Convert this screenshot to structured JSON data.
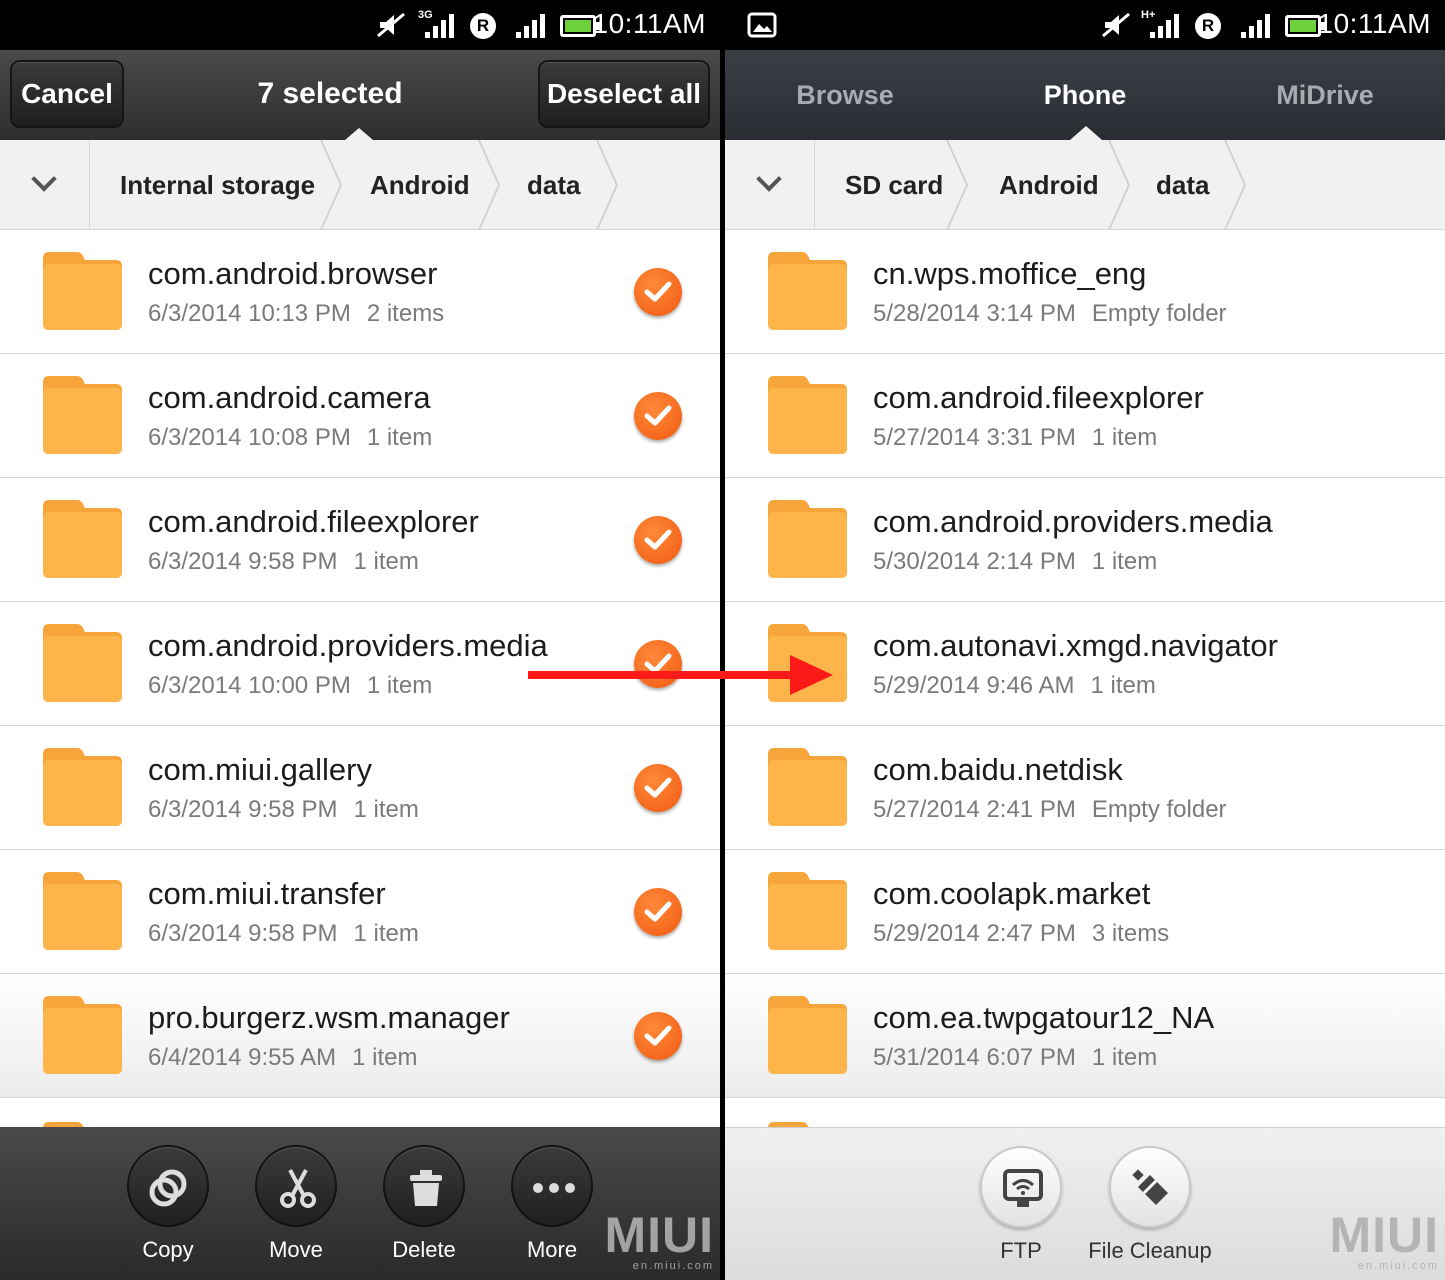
{
  "left": {
    "status": {
      "time": "10:11AM",
      "network": "3G",
      "roaming": "R"
    },
    "topbar": {
      "cancel": "Cancel",
      "title": "7 selected",
      "deselect": "Deselect all"
    },
    "breadcrumb": [
      "Internal storage",
      "Android",
      "data"
    ],
    "rows": [
      {
        "name": "com.android.browser",
        "date": "6/3/2014 10:13 PM",
        "count": "2 items"
      },
      {
        "name": "com.android.camera",
        "date": "6/3/2014 10:08 PM",
        "count": "1 item"
      },
      {
        "name": "com.android.fileexplorer",
        "date": "6/3/2014 9:58 PM",
        "count": "1 item"
      },
      {
        "name": "com.android.providers.media",
        "date": "6/3/2014 10:00 PM",
        "count": "1 item"
      },
      {
        "name": "com.miui.gallery",
        "date": "6/3/2014 9:58 PM",
        "count": "1 item"
      },
      {
        "name": "com.miui.transfer",
        "date": "6/3/2014 9:58 PM",
        "count": "1 item"
      },
      {
        "name": "pro.burgerz.wsm.manager",
        "date": "6/4/2014 9:55 AM",
        "count": "1 item"
      }
    ],
    "toolbar": [
      "Copy",
      "Move",
      "Delete",
      "More"
    ],
    "watermark": {
      "logo": "MIUI",
      "url": "en.miui.com"
    }
  },
  "right": {
    "status": {
      "time": "10:11AM",
      "network": "H+",
      "roaming": "R"
    },
    "tabs": [
      "Browse",
      "Phone",
      "MiDrive"
    ],
    "breadcrumb": [
      "SD card",
      "Android",
      "data"
    ],
    "rows": [
      {
        "name": "cn.wps.moffice_eng",
        "date": "5/28/2014 3:14 PM",
        "count": "Empty folder"
      },
      {
        "name": "com.android.fileexplorer",
        "date": "5/27/2014 3:31 PM",
        "count": "1 item"
      },
      {
        "name": "com.android.providers.media",
        "date": "5/30/2014 2:14 PM",
        "count": "1 item"
      },
      {
        "name": "com.autonavi.xmgd.navigator",
        "date": "5/29/2014 9:46 AM",
        "count": "1 item"
      },
      {
        "name": "com.baidu.netdisk",
        "date": "5/27/2014 2:41 PM",
        "count": "Empty folder"
      },
      {
        "name": "com.coolapk.market",
        "date": "5/29/2014 2:47 PM",
        "count": "3 items"
      },
      {
        "name": "com.ea.twpgatour12_NA",
        "date": "5/31/2014 6:07 PM",
        "count": "1 item"
      }
    ],
    "toolbar": [
      "FTP",
      "File Cleanup"
    ],
    "watermark": {
      "logo": "MIUI",
      "url": "en.miui.com"
    }
  },
  "colors": {
    "accent": "#f26a1b",
    "folder": "#fbb040",
    "arrow": "#ff1a1a"
  },
  "icons": {
    "left_toolbar": [
      "copy-icon",
      "scissors-icon",
      "trash-icon",
      "more-icon"
    ],
    "right_toolbar": [
      "ftp-icon",
      "broom-icon"
    ]
  }
}
